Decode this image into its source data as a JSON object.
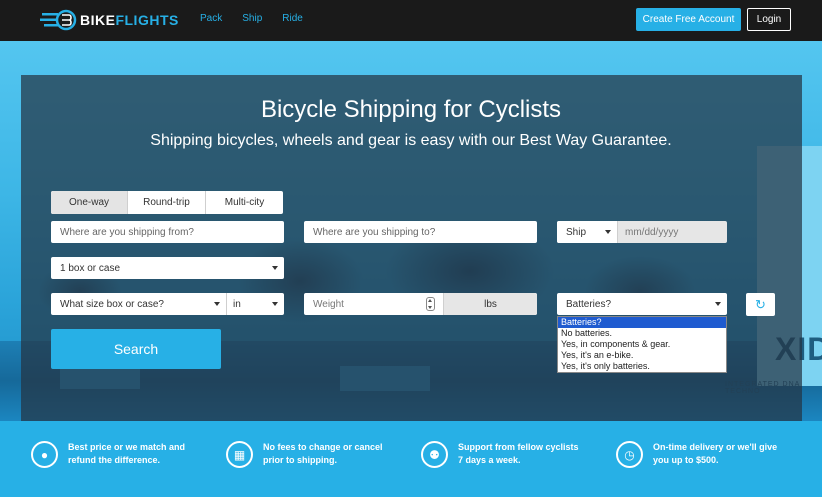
{
  "header": {
    "brand_left": "BIKE",
    "brand_right": "FLIGHTS",
    "nav": [
      {
        "label": "Pack"
      },
      {
        "label": "Ship"
      },
      {
        "label": "Ride"
      }
    ],
    "create_account_label": "Create Free Account",
    "login_label": "Login"
  },
  "hero": {
    "title": "Bicycle Shipping for Cyclists",
    "subtitle": "Shipping bicycles, wheels and gear is easy with our Best Way Guarantee.",
    "background_banner_text": "XIDT",
    "background_banner_sub": "INTEGRATED DNA TECHNO"
  },
  "form": {
    "trip_tabs": [
      {
        "label": "One-way",
        "active": true
      },
      {
        "label": "Round-trip",
        "active": false
      },
      {
        "label": "Multi-city",
        "active": false
      }
    ],
    "from_placeholder": "Where are you shipping from?",
    "to_placeholder": "Where are you shipping to?",
    "ship_select": "Ship",
    "date_placeholder": "mm/dd/yyyy",
    "quantity_select": "1 box or case",
    "size_select": "What size box or case?",
    "unit_select": "in",
    "weight_placeholder": "Weight",
    "weight_unit": "lbs",
    "batteries_select": "Batteries?",
    "batteries_options": [
      {
        "label": "Batteries?",
        "selected": true
      },
      {
        "label": "No batteries.",
        "selected": false
      },
      {
        "label": "Yes, in components & gear.",
        "selected": false
      },
      {
        "label": "Yes, it's an e-bike.",
        "selected": false
      },
      {
        "label": "Yes, it's only batteries.",
        "selected": false
      }
    ],
    "search_label": "Search"
  },
  "benefits": [
    {
      "icon": "piggy-bank-icon",
      "text": "Best price or we match and refund the difference."
    },
    {
      "icon": "calendar-icon",
      "text": "No fees to change or cancel prior to shipping."
    },
    {
      "icon": "support-icon",
      "text": "Support from fellow cyclists 7 days a week."
    },
    {
      "icon": "clock-icon",
      "text": "On-time delivery or we'll give you up to $500."
    }
  ],
  "colors": {
    "accent": "#27b0e6",
    "header_bg": "#1a1a1a",
    "panel_bg": "#243444",
    "option_highlight": "#1f5bd0"
  }
}
